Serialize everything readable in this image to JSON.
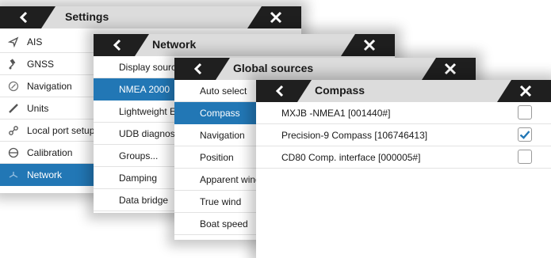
{
  "settings": {
    "title": "Settings",
    "items": [
      {
        "label": "AIS",
        "icon": "ais-icon"
      },
      {
        "label": "GNSS",
        "icon": "gnss-icon"
      },
      {
        "label": "Navigation",
        "icon": "navigation-icon"
      },
      {
        "label": "Units",
        "icon": "units-icon"
      },
      {
        "label": "Local port setup",
        "icon": "local-port-icon"
      },
      {
        "label": "Calibration",
        "icon": "calibration-icon"
      },
      {
        "label": "Network",
        "icon": "network-icon",
        "selected": true
      }
    ]
  },
  "network": {
    "title": "Network",
    "items": [
      {
        "label": "Display sources"
      },
      {
        "label": "NMEA 2000",
        "selected": true
      },
      {
        "label": "Lightweight Ethernet"
      },
      {
        "label": "UDB diagnostics"
      },
      {
        "label": "Groups..."
      },
      {
        "label": "Damping"
      },
      {
        "label": "Data bridge"
      }
    ]
  },
  "global_sources": {
    "title": "Global sources",
    "items": [
      {
        "label": "Auto select"
      },
      {
        "label": "Compass",
        "selected": true
      },
      {
        "label": "Navigation"
      },
      {
        "label": "Position"
      },
      {
        "label": "Apparent wind"
      },
      {
        "label": "True wind"
      },
      {
        "label": "Boat speed"
      }
    ]
  },
  "compass": {
    "title": "Compass",
    "items": [
      {
        "label": "MXJB -NMEA1 [001440#]",
        "checked": false
      },
      {
        "label": "Precision-9 Compass [106746413]",
        "checked": true
      },
      {
        "label": "CD80 Comp. interface [000005#]",
        "checked": false
      }
    ]
  },
  "colors": {
    "selected": "#2277b5",
    "titlebar": "#dcdcdc",
    "titlebar_dark": "#1f1f1f",
    "check": "#2277b5"
  }
}
